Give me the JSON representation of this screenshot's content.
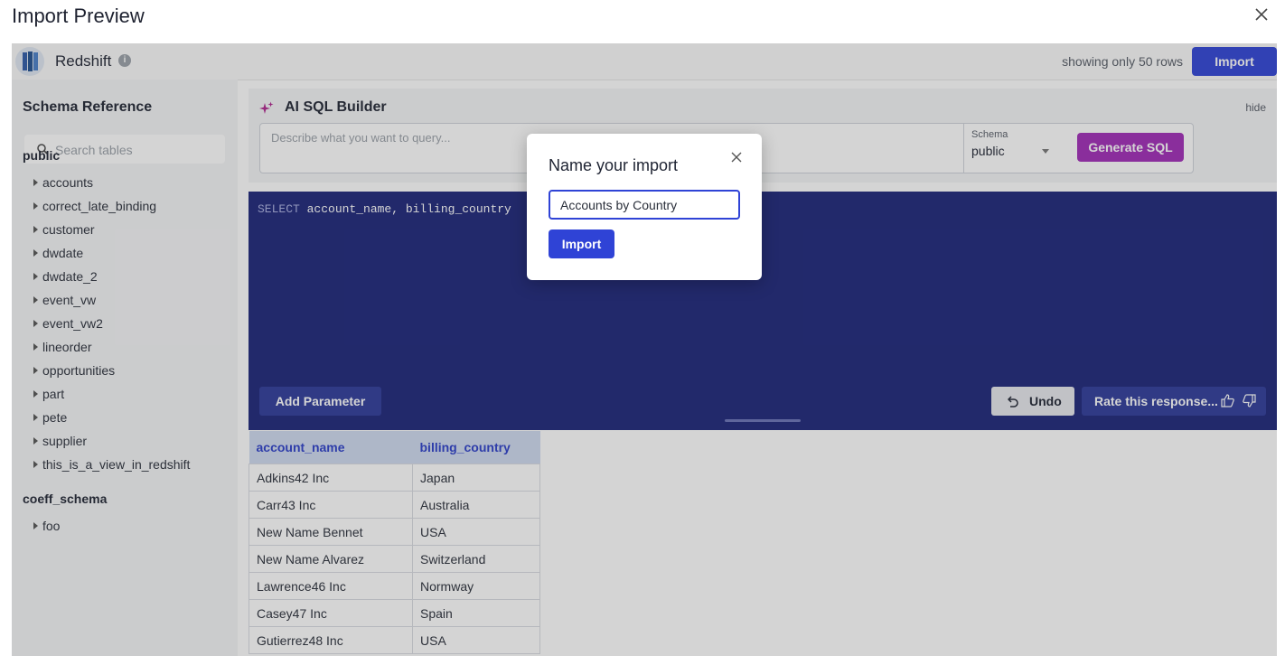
{
  "window": {
    "title": "Import Preview",
    "close_icon": "close-icon"
  },
  "header": {
    "source_name": "Redshift",
    "info_icon": "i",
    "rows_note": "showing only 50 rows",
    "import_label": "Import"
  },
  "sidebar": {
    "title": "Schema Reference",
    "search_placeholder": "Search tables",
    "schemas": [
      {
        "name": "public",
        "tables": [
          "accounts",
          "correct_late_binding",
          "customer",
          "dwdate",
          "dwdate_2",
          "event_vw",
          "event_vw2",
          "lineorder",
          "opportunities",
          "part",
          "pete",
          "supplier",
          "this_is_a_view_in_redshift"
        ]
      },
      {
        "name": "coeff_schema",
        "tables": [
          "foo"
        ]
      }
    ]
  },
  "ai_builder": {
    "title": "AI SQL Builder",
    "hide_label": "hide",
    "prompt_placeholder": "Describe what you want to query...",
    "schema_label": "Schema",
    "schema_value": "public",
    "generate_label": "Generate SQL"
  },
  "editor": {
    "sql_keyword": "SELECT",
    "sql_rest": " account_name, billing_country",
    "add_parameter_label": "Add Parameter",
    "undo_label": "Undo",
    "rate_label": "Rate this response..."
  },
  "results": {
    "columns": [
      "account_name",
      "billing_country"
    ],
    "rows": [
      [
        "Adkins42 Inc",
        "Japan"
      ],
      [
        "Carr43 Inc",
        "Australia"
      ],
      [
        "New Name Bennet",
        "USA"
      ],
      [
        "New Name Alvarez",
        "Switzerland"
      ],
      [
        "Lawrence46 Inc",
        "Normway"
      ],
      [
        "Casey47 Inc",
        "Spain"
      ],
      [
        "Gutierrez48 Inc",
        "USA"
      ]
    ]
  },
  "modal": {
    "title": "Name your import",
    "input_value": "Accounts by Country",
    "import_label": "Import",
    "close_label": "X"
  },
  "colors": {
    "primary": "#2f43d6",
    "editor_bg": "#1b2479",
    "generate": "#a12bb8"
  }
}
